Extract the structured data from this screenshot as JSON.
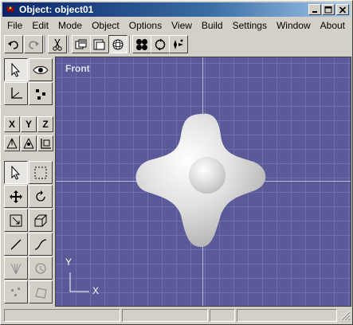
{
  "window": {
    "title": "Object: object01",
    "icon": "application-icon",
    "controls": [
      "minimize-icon",
      "maximize-icon",
      "close-icon"
    ]
  },
  "menu": [
    {
      "label": "File"
    },
    {
      "label": "Edit"
    },
    {
      "label": "Mode"
    },
    {
      "label": "Object"
    },
    {
      "label": "Options"
    },
    {
      "label": "View"
    },
    {
      "label": "Build"
    },
    {
      "label": "Settings"
    },
    {
      "label": "Window"
    },
    {
      "label": "About"
    }
  ],
  "toolbar": {
    "buttons": [
      {
        "icon": "undo-icon"
      },
      {
        "icon": "redo-icon"
      },
      {
        "icon": "scissors-icon"
      },
      {
        "icon": "copy-icon"
      },
      {
        "icon": "paste-icon"
      },
      {
        "icon": "sphere-icon",
        "pressed": true
      },
      {
        "icon": "four-balls-icon"
      },
      {
        "icon": "rotate-icon"
      },
      {
        "icon": "sparkle-icon"
      }
    ]
  },
  "palette": {
    "axis_buttons": [
      {
        "label": "X"
      },
      {
        "label": "Y"
      },
      {
        "label": "Z"
      }
    ]
  },
  "viewport": {
    "label": "Front",
    "axis_x": "X",
    "axis_y": "Y",
    "background_color": "#5a5a98",
    "object_color": "#e0e0e0"
  },
  "statusbar": {
    "cells": [
      "",
      "",
      "",
      ""
    ]
  }
}
